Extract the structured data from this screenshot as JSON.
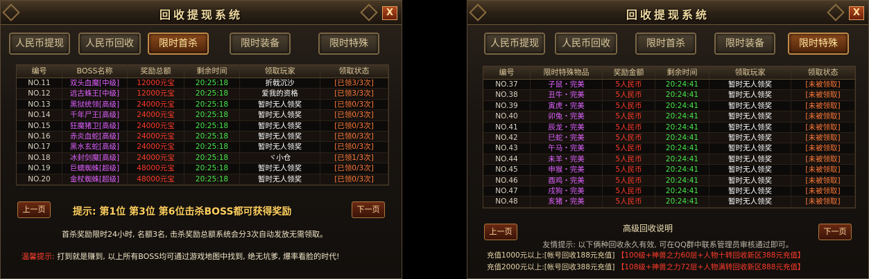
{
  "left": {
    "title": "回收提现系统",
    "close_label": "X",
    "tabs": [
      "人民币提现",
      "人民币回收",
      "限时首杀",
      "限时装备",
      "限时特殊"
    ],
    "active_tab": 2,
    "columns": [
      "编号",
      "BOSS名称",
      "奖励总额",
      "剩余时间",
      "领取玩家",
      "领取状态"
    ],
    "rows": [
      [
        "NO.11",
        "双头血魔[中级]",
        "12000元宝",
        "20:25:18",
        "折戟沉沙",
        "[已领3/3次]"
      ],
      [
        "NO.12",
        "远古蛛王[中级]",
        "12000元宝",
        "20:25:18",
        "爱我的资格",
        "[已领3/3次]"
      ],
      [
        "NO.13",
        "黑狱统领[高级]",
        "24000元宝",
        "20:25:18",
        "暂时无人领奖",
        "[已领0/3次]"
      ],
      [
        "NO.14",
        "千年尸王[高级]",
        "24000元宝",
        "20:25:18",
        "暂时无人领奖",
        "[已领0/3次]"
      ],
      [
        "NO.15",
        "狂魔猪卫[高级]",
        "24000元宝",
        "20:25:18",
        "暂时无人领奖",
        "[已领0/3次]"
      ],
      [
        "NO.16",
        "赤炎血蛇[高级]",
        "24000元宝",
        "20:25:18",
        "暂时无人领奖",
        "[已领0/3次]"
      ],
      [
        "NO.17",
        "黑水玄蛇[高级]",
        "24000元宝",
        "20:25:18",
        "暂时无人领奖",
        "[已领0/3次]"
      ],
      [
        "NO.18",
        "冰封剑魔[高级]",
        "24000元宝",
        "20:25:18",
        "ヾ小仓",
        "[已领1/3次]"
      ],
      [
        "NO.19",
        "巨蠕蜘蛛[超级]",
        "48000元宝",
        "20:25:18",
        "暂时无人领奖",
        "[已领0/3次]"
      ],
      [
        "NO.20",
        "金杖蜘蛛[超级]",
        "48000元宝",
        "20:25:18",
        "暂时无人领奖",
        "[已领0/3次]"
      ]
    ],
    "prev_label": "上一页",
    "next_label": "下一页",
    "hint": "提示: 第1位  第3位  第6位击杀BOSS都可获得奖励",
    "note1": "首杀奖励限时24小时, 名额3名, 击杀奖励总额系统会分3次自动发放无需领取。",
    "warm_label": "温馨提示:",
    "note2": "打到就是赚到, 以上所有BOSS均可通过游戏地图中找到, 绝无坑爹, 爆率看脸的时代!"
  },
  "right": {
    "title": "回收提现系统",
    "close_label": "X",
    "tabs": [
      "人民币提现",
      "人民币回收",
      "限时首杀",
      "限时装备",
      "限时特殊"
    ],
    "active_tab": 4,
    "columns": [
      "编号",
      "限时特殊物品",
      "奖励金额",
      "剩余时间",
      "领取玩家",
      "领取状态"
    ],
    "rows": [
      [
        "NO.37",
        "子鼠・完美",
        "5人民币",
        "20:24:41",
        "暂时无人领奖",
        "[未被领取]"
      ],
      [
        "NO.38",
        "丑牛・完美",
        "5人民币",
        "20:24:41",
        "暂时无人领奖",
        "[未被领取]"
      ],
      [
        "NO.39",
        "寅虎・完美",
        "5人民币",
        "20:24:41",
        "暂时无人领奖",
        "[未被领取]"
      ],
      [
        "NO.40",
        "卯兔・完美",
        "5人民币",
        "20:24:41",
        "暂时无人领奖",
        "[未被领取]"
      ],
      [
        "NO.41",
        "辰龙・完美",
        "5人民币",
        "20:24:41",
        "暂时无人领奖",
        "[未被领取]"
      ],
      [
        "NO.42",
        "巳蛇・完美",
        "5人民币",
        "20:24:41",
        "暂时无人领奖",
        "[未被领取]"
      ],
      [
        "NO.43",
        "午马・完美",
        "5人民币",
        "20:24:41",
        "暂时无人领奖",
        "[未被领取]"
      ],
      [
        "NO.44",
        "未羊・完美",
        "5人民币",
        "20:24:41",
        "暂时无人领奖",
        "[未被领取]"
      ],
      [
        "NO.45",
        "申猴・完美",
        "5人民币",
        "20:24:41",
        "暂时无人领奖",
        "[未被领取]"
      ],
      [
        "NO.46",
        "酉鸡・完美",
        "5人民币",
        "20:24:41",
        "暂时无人领奖",
        "[未被领取]"
      ],
      [
        "NO.47",
        "戌狗・完美",
        "5人民币",
        "20:24:41",
        "暂时无人领奖",
        "[未被领取]"
      ],
      [
        "NO.48",
        "亥猪・完美",
        "5人民币",
        "20:24:41",
        "暂时无人领奖",
        "[未被领取]"
      ]
    ],
    "prev_label": "上一页",
    "next_label": "下一页",
    "section_title": "高级回收说明",
    "tip": "友情提示: 以下俩种回收永久有效, 可在QQ群中联系管理员审核通过即可。",
    "offers": [
      {
        "lhs": "充值1000元以上:[帐号回收188元充值]",
        "rhs": "【100级+神兽之力60层+人物十转回收新区388元充值】"
      },
      {
        "lhs": "充值2000元以上:[帐号回收388元充值]",
        "rhs": "【108级+神兽之力72层+人物满转回收新区888元充值】"
      }
    ]
  }
}
